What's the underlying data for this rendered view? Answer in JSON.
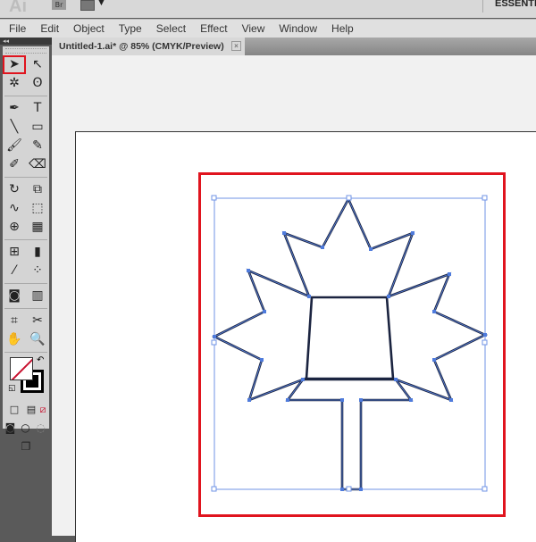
{
  "app": {
    "logo": "Ai",
    "bridge": "Br",
    "workspace": "ESSENTIALS"
  },
  "menu": [
    "File",
    "Edit",
    "Object",
    "Type",
    "Select",
    "Effect",
    "View",
    "Window",
    "Help"
  ],
  "document": {
    "tab_title": "Untitled-1.ai* @ 85% (CMYK/Preview)",
    "close": "×",
    "zoom": "85%",
    "color_mode": "CMYK/Preview"
  },
  "tools": [
    {
      "name": "selection-tool",
      "glyph": "➤",
      "selected": true
    },
    {
      "name": "direct-selection-tool",
      "glyph": "↖"
    },
    {
      "name": "magic-wand-tool",
      "glyph": "✲"
    },
    {
      "name": "lasso-tool",
      "glyph": "ʘ"
    },
    {
      "name": "pen-tool",
      "glyph": "✒"
    },
    {
      "name": "type-tool",
      "glyph": "T"
    },
    {
      "name": "line-tool",
      "glyph": "╲"
    },
    {
      "name": "rectangle-tool",
      "glyph": "▭"
    },
    {
      "name": "paintbrush-tool",
      "glyph": "🖌"
    },
    {
      "name": "pencil-tool",
      "glyph": "✎"
    },
    {
      "name": "blob-brush-tool",
      "glyph": "✐"
    },
    {
      "name": "eraser-tool",
      "glyph": "⌫"
    },
    {
      "name": "rotate-tool",
      "glyph": "↻"
    },
    {
      "name": "scale-tool",
      "glyph": "⧉"
    },
    {
      "name": "warp-tool",
      "glyph": "∿"
    },
    {
      "name": "free-transform-tool",
      "glyph": "⬚"
    },
    {
      "name": "shape-builder-tool",
      "glyph": "⊕"
    },
    {
      "name": "perspective-grid-tool",
      "glyph": "▦"
    },
    {
      "name": "mesh-tool",
      "glyph": "⊞"
    },
    {
      "name": "gradient-tool",
      "glyph": "▮"
    },
    {
      "name": "eyedropper-tool",
      "glyph": "⁄"
    },
    {
      "name": "blend-tool",
      "glyph": "⁘"
    },
    {
      "name": "symbol-sprayer-tool",
      "glyph": "◙"
    },
    {
      "name": "column-graph-tool",
      "glyph": "▥"
    },
    {
      "name": "artboard-tool",
      "glyph": "⌗"
    },
    {
      "name": "slice-tool",
      "glyph": "✂"
    },
    {
      "name": "hand-tool",
      "glyph": "✋"
    },
    {
      "name": "zoom-tool",
      "glyph": "🔍"
    }
  ],
  "colors": {
    "highlight": "#e0141e",
    "selection": "#4f7bdc",
    "stroke": "#1b2440",
    "none_slash": "#c8102e"
  }
}
